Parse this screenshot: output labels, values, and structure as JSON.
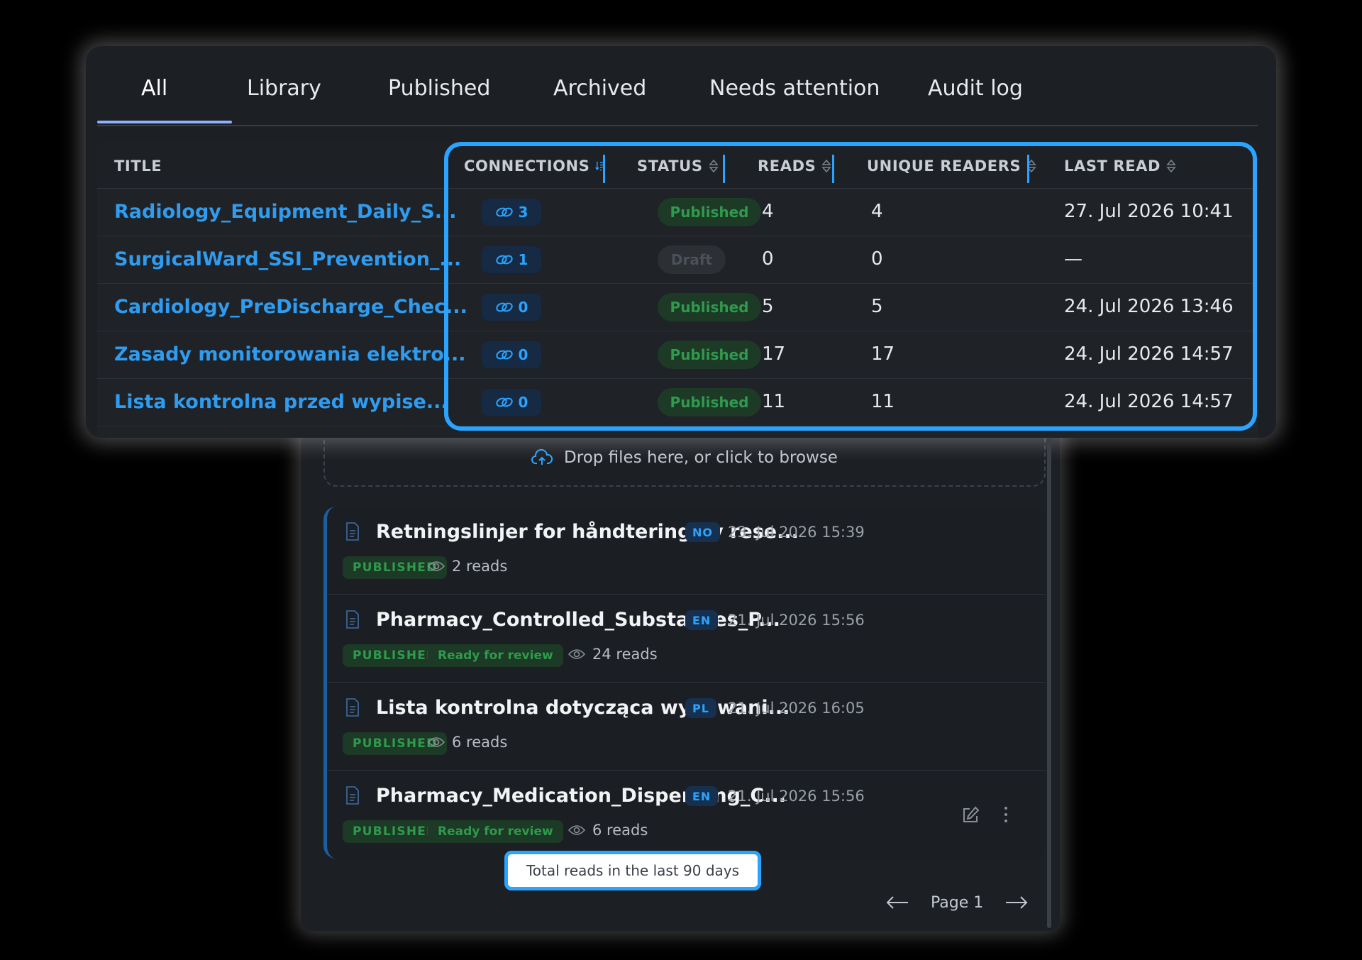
{
  "tabs": [
    {
      "label": "All",
      "active": true
    },
    {
      "label": "Library"
    },
    {
      "label": "Published"
    },
    {
      "label": "Archived"
    },
    {
      "label": "Needs attention"
    },
    {
      "label": "Audit log"
    }
  ],
  "table": {
    "headers": {
      "title": "TITLE",
      "connections": "CONNECTIONS",
      "status": "STATUS",
      "reads": "READS",
      "unique_readers": "UNIQUE READERS",
      "last_read": "LAST READ"
    },
    "sorted_column": "connections",
    "rows": [
      {
        "title": "Radiology_Equipment_Daily_S...",
        "connections": "3",
        "status": "Published",
        "reads": "4",
        "unique": "4",
        "last_read": "27. Jul 2026 10:41"
      },
      {
        "title": "SurgicalWard_SSI_Prevention_...",
        "connections": "1",
        "status": "Draft",
        "reads": "0",
        "unique": "0",
        "last_read": "—"
      },
      {
        "title": "Cardiology_PreDischarge_Chec...",
        "connections": "0",
        "status": "Published",
        "reads": "5",
        "unique": "5",
        "last_read": "24. Jul 2026 13:46"
      },
      {
        "title": "Zasady monitorowania elektro...",
        "connections": "0",
        "status": "Published",
        "reads": "17",
        "unique": "17",
        "last_read": "24. Jul 2026 14:57"
      },
      {
        "title": "Lista kontrolna przed wypise...",
        "connections": "0",
        "status": "Published",
        "reads": "11",
        "unique": "11",
        "last_read": "24. Jul 2026 14:57"
      }
    ]
  },
  "dropzone": {
    "text": "Drop files here, or click to browse",
    "icon": "cloud-upload-icon"
  },
  "list": {
    "items": [
      {
        "title": "Retningslinjer for håndtering av rese...",
        "lang": "NO",
        "date": "23. Jul 2026 15:39",
        "tags": [
          "PUBLISHED"
        ],
        "reads": "2 reads"
      },
      {
        "title": "Pharmacy_Controlled_Substances_P...",
        "lang": "EN",
        "date": "21. Jul 2026 15:56",
        "tags": [
          "PUBLISHED",
          "Ready for review"
        ],
        "reads": "24 reads"
      },
      {
        "title": "Lista kontrolna dotycząca wydawani...",
        "lang": "PL",
        "date": "21. Jul 2026 16:05",
        "tags": [
          "PUBLISHED"
        ],
        "reads": "6 reads"
      },
      {
        "title": "Pharmacy_Medication_Dispensing_C...",
        "lang": "EN",
        "date": "21. Jul 2026 15:56",
        "tags": [
          "PUBLISHED",
          "Ready for review"
        ],
        "reads": "6 reads",
        "actions": [
          "edit-icon",
          "more-vertical-icon"
        ]
      }
    ]
  },
  "tooltip": {
    "text": "Total reads in the last 90 days"
  },
  "pagination": {
    "label": "Page 1",
    "prev_icon": "arrow-left-icon",
    "next_icon": "arrow-right-icon"
  },
  "colors": {
    "accent": "#2aa4ff",
    "link": "#2f9cf0",
    "published_bg": "#1c3a26",
    "published_text": "#2f9a4d",
    "panel_bg": "#1c1f24",
    "page_bg": "#000000"
  }
}
